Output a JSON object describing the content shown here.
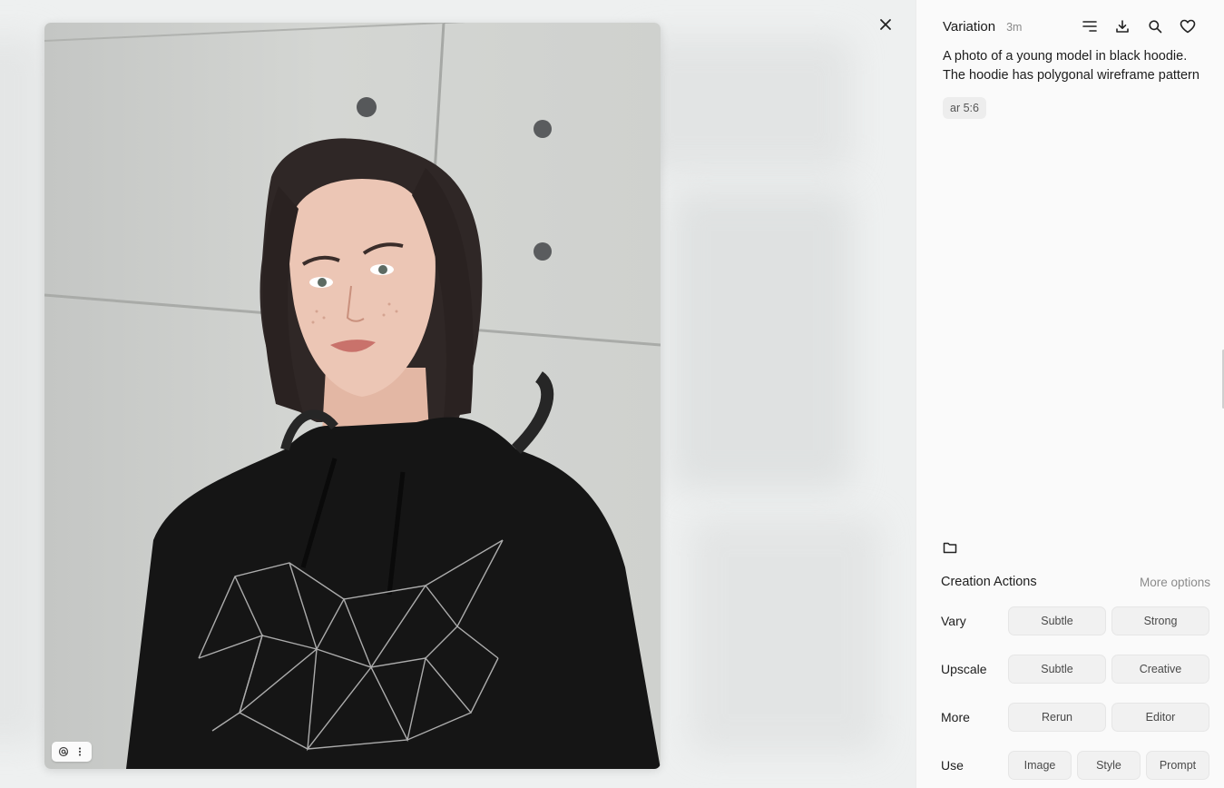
{
  "header": {
    "title": "Variation",
    "time": "3m",
    "icons": [
      "menu-lines-icon",
      "download-icon",
      "search-icon",
      "heart-icon"
    ]
  },
  "viewer": {
    "close_icon": "close-icon",
    "chip_icons": [
      "at-icon",
      "more-vertical-icon"
    ]
  },
  "prompt": {
    "line1": "A photo of a young model in black hoodie.",
    "line2": "The hoodie has polygonal wireframe pattern",
    "param": "ar 5:6"
  },
  "actions": {
    "folder_icon": "folder-icon",
    "title": "Creation Actions",
    "more_options": "More options",
    "rows": [
      {
        "label": "Vary",
        "buttons": [
          "Subtle",
          "Strong"
        ]
      },
      {
        "label": "Upscale",
        "buttons": [
          "Subtle",
          "Creative"
        ]
      },
      {
        "label": "More",
        "buttons": [
          "Rerun",
          "Editor"
        ]
      },
      {
        "label": "Use",
        "buttons": [
          "Image",
          "Style",
          "Prompt"
        ]
      }
    ]
  }
}
